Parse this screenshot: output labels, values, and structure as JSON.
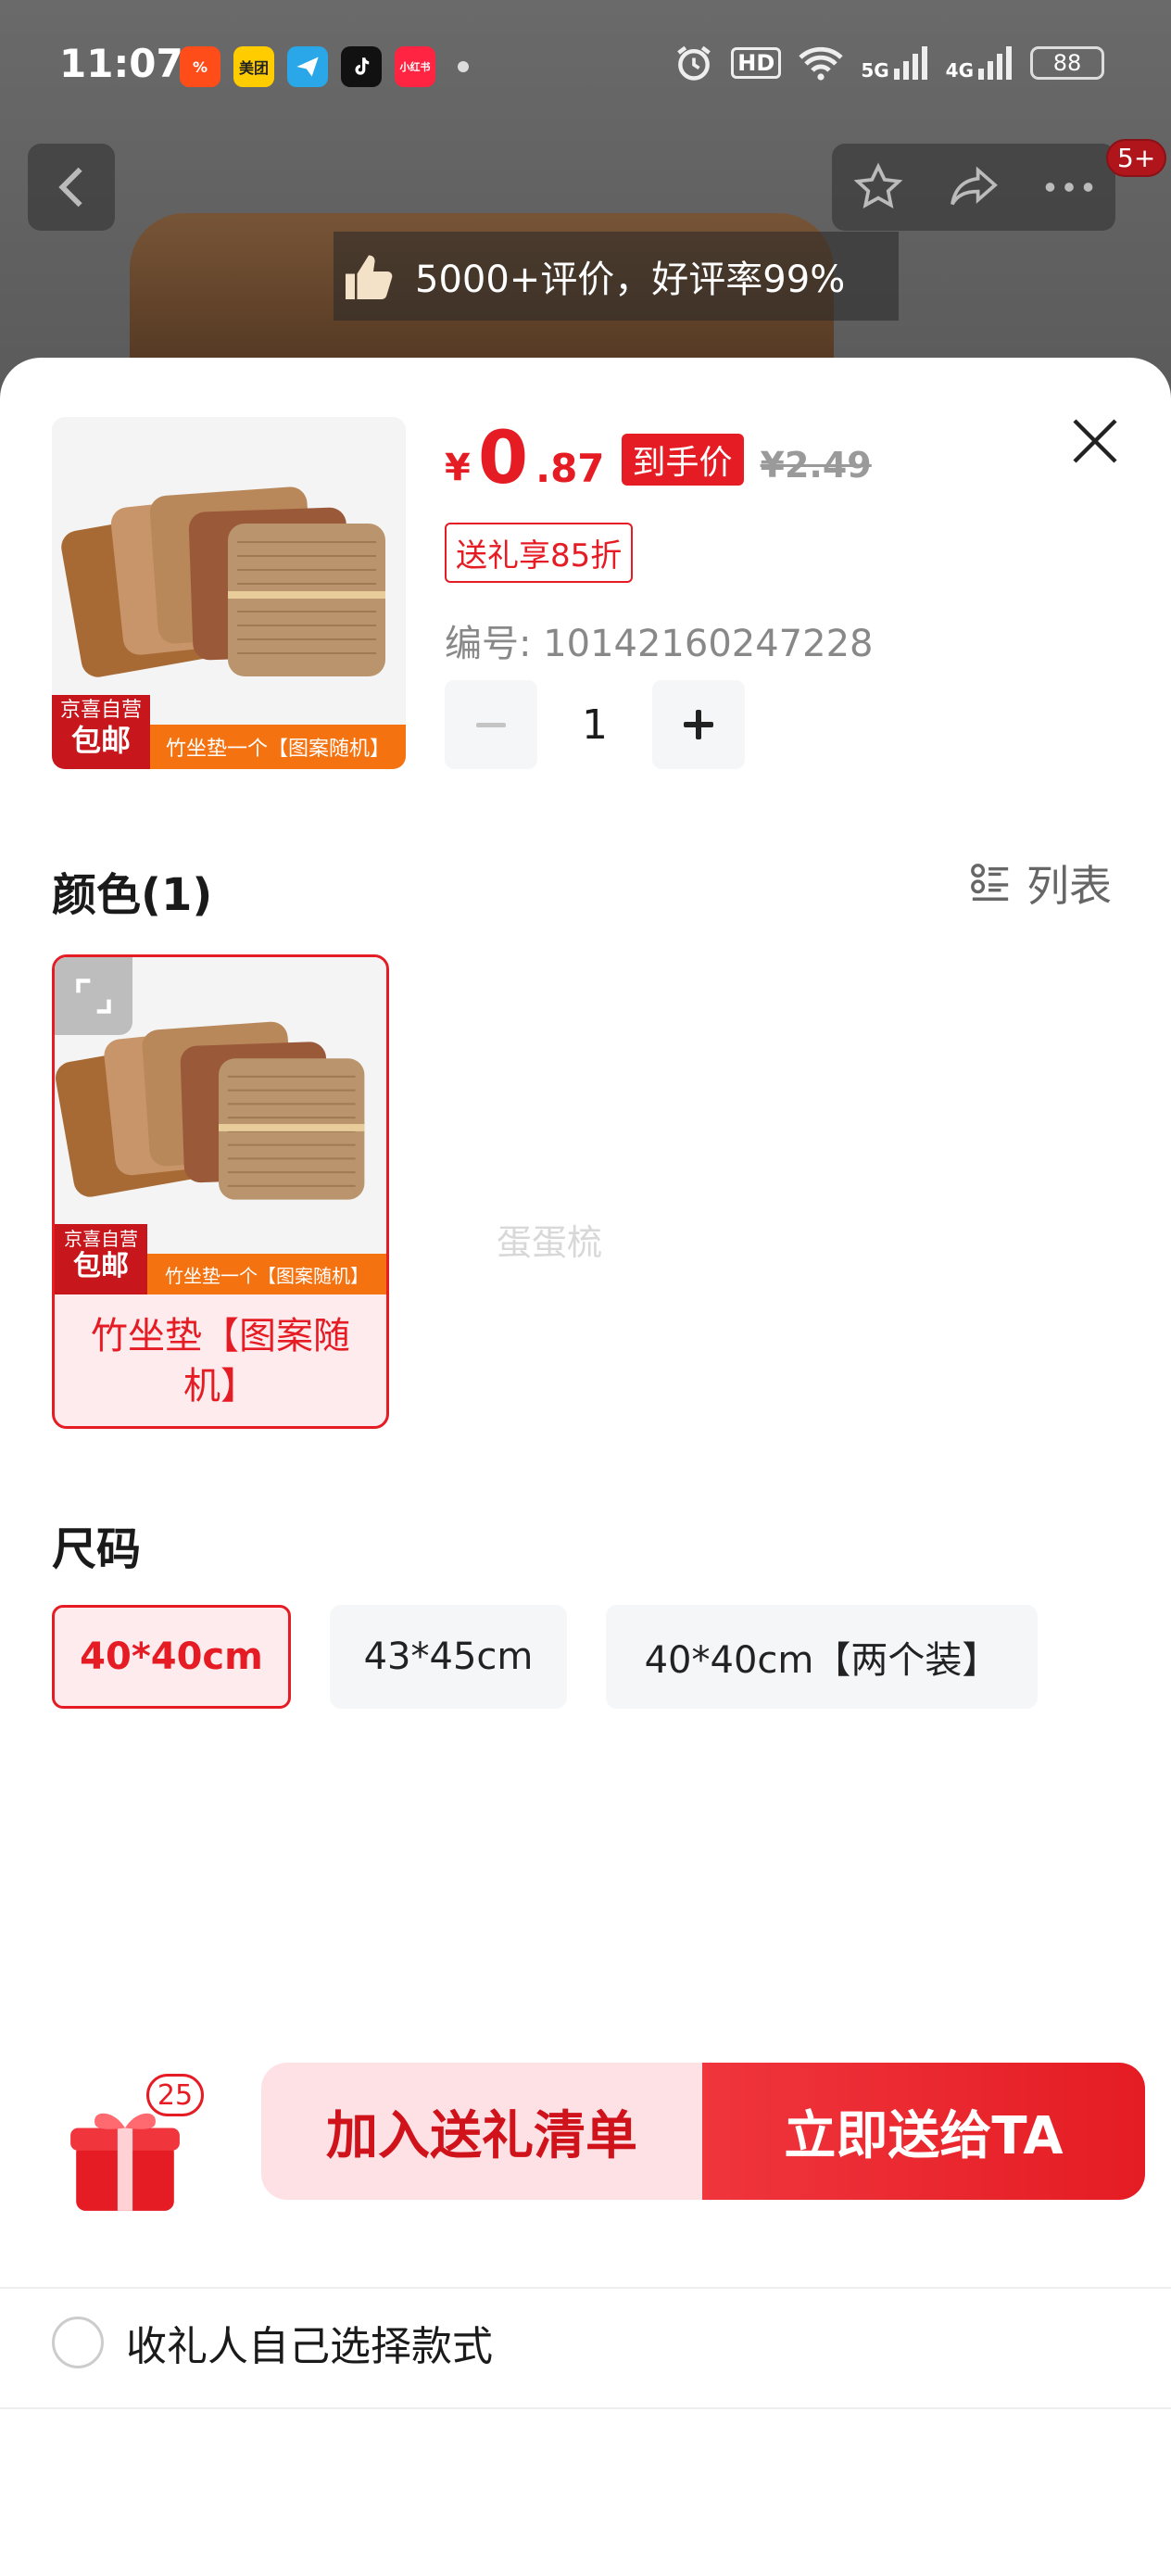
{
  "status_bar": {
    "time": "11:07",
    "apps": [
      {
        "icon": "meituan-waimai-icon",
        "label": "",
        "color": "#ff4d1a"
      },
      {
        "icon": "meituan-icon",
        "label": "美团",
        "color": "#ffcc00"
      },
      {
        "icon": "paper-plane-icon",
        "label": "",
        "color": "#2aa7e8"
      },
      {
        "icon": "tiktok-icon",
        "label": "",
        "color": "#111111"
      },
      {
        "icon": "xiaohongshu-icon",
        "label": "小红书",
        "color": "#ff2442"
      }
    ],
    "network_5g": "5G",
    "network_4g": "4G",
    "hd_label": "HD",
    "battery": "88"
  },
  "header": {
    "cart_badge": "5+",
    "review_text": "5000+评价，好评率99%"
  },
  "product": {
    "price_symbol": "¥",
    "price_int": "0",
    "price_dec": ".87",
    "price_tag": "到手价",
    "original_price": "¥2.49",
    "promo": "送礼享85折",
    "sku": "编号: 10142160247228",
    "quantity": "1",
    "thumb_tag_small": "京喜自营",
    "thumb_tag_big": "包邮",
    "thumb_strip": "竹坐垫一个【图案随机】"
  },
  "color_section": {
    "title": "颜色(1)",
    "list_toggle": "列表",
    "options": [
      {
        "label": "竹坐垫【图案随机】",
        "selected": true
      }
    ],
    "watermark": "蛋蛋梳"
  },
  "size_section": {
    "title": "尺码",
    "options": [
      {
        "label": "40*40cm",
        "selected": true
      },
      {
        "label": "43*45cm",
        "selected": false
      },
      {
        "label": "40*40cm【两个装】",
        "selected": false
      }
    ]
  },
  "footer": {
    "self_select": "收礼人自己选择款式",
    "gift_badge": "25",
    "add_button": "加入送礼清单",
    "send_button": "立即送给TA"
  },
  "colors": {
    "accent": "#e51c23",
    "accent_light": "#fdebee",
    "chip_bg": "#f5f6f8"
  }
}
